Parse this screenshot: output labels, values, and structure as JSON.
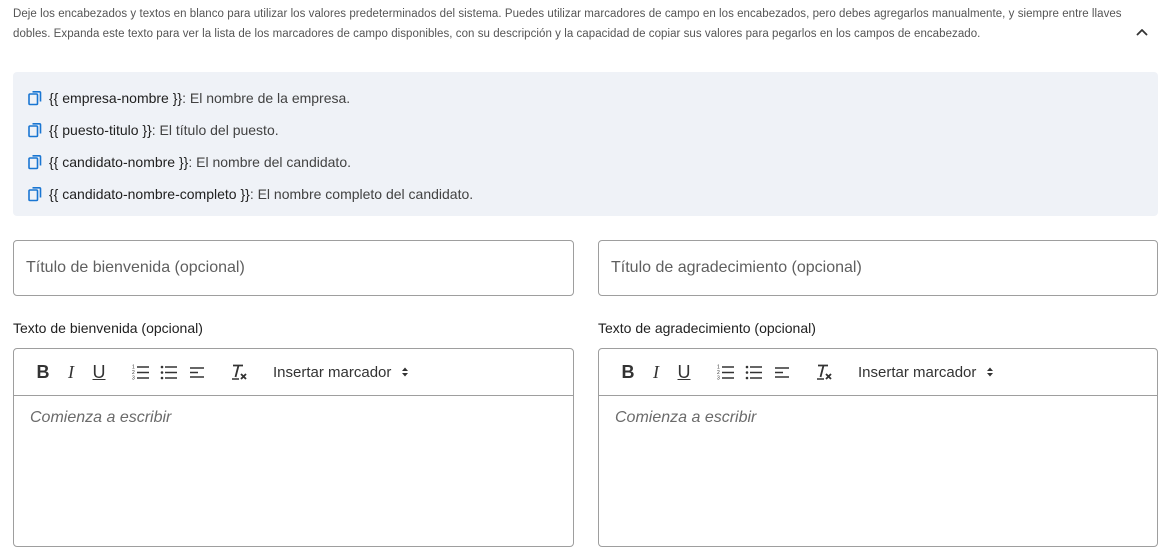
{
  "help": {
    "text": "Deje los encabezados y textos en blanco para utilizar los valores predeterminados del sistema. Puedes utilizar marcadores de campo en los encabezados, pero debes agregarlos manualmente, y siempre entre llaves dobles. Expanda este texto para ver la lista de los marcadores de campo disponibles, con su descripción y la capacidad de copiar sus valores para pegarlos en los campos de encabezado.",
    "collapse_icon": "chevron-up-icon"
  },
  "placeholders": [
    {
      "key": "{{ empresa-nombre }}",
      "desc": ": El nombre de la empresa."
    },
    {
      "key": "{{ puesto-titulo }}",
      "desc": ": El título del puesto."
    },
    {
      "key": "{{ candidato-nombre }}",
      "desc": ": El nombre del candidato."
    },
    {
      "key": "{{ candidato-nombre-completo }}",
      "desc": ": El nombre completo del candidato."
    }
  ],
  "fields": {
    "welcome_title_placeholder": "Título de bienvenida (opcional)",
    "thanks_title_placeholder": "Título de agradecimiento (opcional)"
  },
  "editors": {
    "welcome": {
      "label": "Texto de bienvenida (opcional)",
      "placeholder": "Comienza a escribir"
    },
    "thanks": {
      "label": "Texto de agradecimiento (opcional)",
      "placeholder": "Comienza a escribir"
    }
  },
  "toolbar": {
    "bold": "B",
    "italic": "I",
    "underline": "U",
    "insert_marker": "Insertar marcador"
  },
  "colors": {
    "accent": "#1976d2",
    "panel_bg": "#eff2f7",
    "border": "#9e9e9e"
  }
}
